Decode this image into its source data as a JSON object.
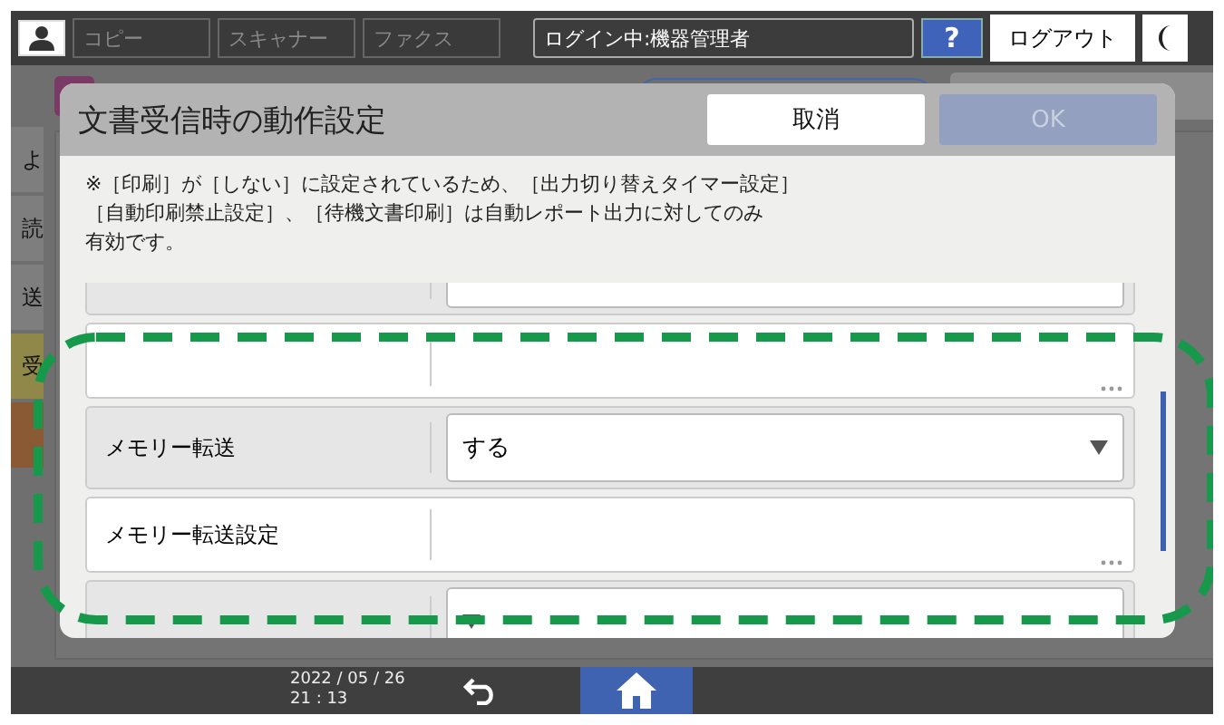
{
  "top_bar": {
    "tabs": [
      {
        "label": "コピー",
        "disabled": true
      },
      {
        "label": "スキャナー",
        "disabled": true
      },
      {
        "label": "ファクス",
        "disabled": true
      }
    ],
    "login": "ログイン中:機器管理者",
    "help": "?",
    "logout": "ログアウト"
  },
  "sidebar": {
    "items": [
      {
        "label": "よ",
        "color": "#7e7e7e"
      },
      {
        "label": "読",
        "color": "#7e7e7e"
      },
      {
        "label": "送",
        "color": "#7e7e7e"
      },
      {
        "label": "受",
        "color": "#8f8848"
      },
      {
        "color": "#8a5a34"
      }
    ]
  },
  "dialog": {
    "title": "文書受信時の動作設定",
    "buttons": [
      {
        "label": "取消",
        "disabled": false
      },
      {
        "label": "OK",
        "disabled": true
      }
    ],
    "notice_lines": [
      "※［印刷］が［しない］に設定されているため、［出力切り替えタイマー設定］",
      "［自動印刷禁止設定］、［待機文書印刷］は自動レポート出力に対してのみ",
      "有効です。"
    ],
    "settings": [
      {
        "kind": "select"
      },
      {
        "kind": "more"
      },
      {
        "kind": "select",
        "label": "メモリー転送",
        "value": "する"
      },
      {
        "kind": "more",
        "label": "メモリー転送設定"
      },
      {
        "kind": "select"
      }
    ]
  },
  "status_bar": {
    "date": "2022 / 05 / 26",
    "time": "21 : 13"
  }
}
